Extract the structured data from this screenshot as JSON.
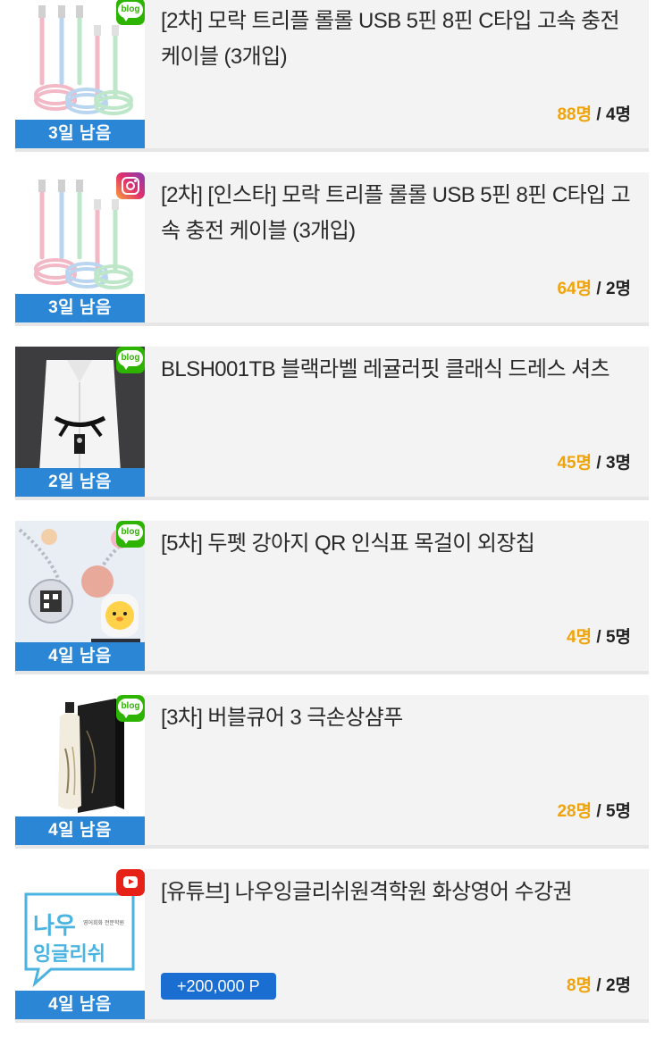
{
  "items": [
    {
      "title": "[2차] 모락 트리플 롤롤 USB 5핀 8핀 C타입 고속 충전 케이블 (3개입)",
      "days_left": "3일 남음",
      "applied": "88명",
      "capacity": "/ 4명",
      "channel": "blog",
      "channel_label": "blog",
      "image": "usb-cable-product-image"
    },
    {
      "title": "[2차] [인스타] 모락 트리플 롤롤 USB 5핀 8핀 C타입 고속 충전 케이블 (3개입)",
      "days_left": "3일 남음",
      "applied": "64명",
      "capacity": "/ 2명",
      "channel": "instagram",
      "image": "usb-cable-product-image"
    },
    {
      "title": "BLSH001TB 블랙라벨 레귤러핏 클래식 드레스 셔츠",
      "days_left": "2일 남음",
      "applied": "45명",
      "capacity": "/ 3명",
      "channel": "blog",
      "channel_label": "blog",
      "image": "dress-shirt-product-image"
    },
    {
      "title": "[5차] 두펫 강아지 QR 인식표 목걸이 외장칩",
      "days_left": "4일 남음",
      "applied": "4명",
      "capacity": "/ 5명",
      "channel": "blog",
      "channel_label": "blog",
      "image": "pet-qr-tag-product-image"
    },
    {
      "title": "[3차] 버블큐어 3 극손상샴푸",
      "days_left": "4일 남음",
      "applied": "28명",
      "capacity": "/ 5명",
      "channel": "blog",
      "channel_label": "blog",
      "image": "shampoo-product-image"
    },
    {
      "title": "[유튜브] 나우잉글리쉬원격학원 화상영어 수강권",
      "days_left": "4일 남음",
      "applied": "8명",
      "capacity": "/ 2명",
      "channel": "youtube",
      "point": "+200,000 P",
      "image": "now-english-logo-image",
      "logo_line1": "나우",
      "logo_line2": "잉글리쉬",
      "logo_small": "영어회화 전문학원"
    }
  ],
  "colors": {
    "days_banner": "#2b87d6",
    "applied_count": "#f0a30a",
    "point_badge": "#1a6ed1",
    "blog_badge": "#2db400",
    "youtube_badge": "#e62117"
  }
}
